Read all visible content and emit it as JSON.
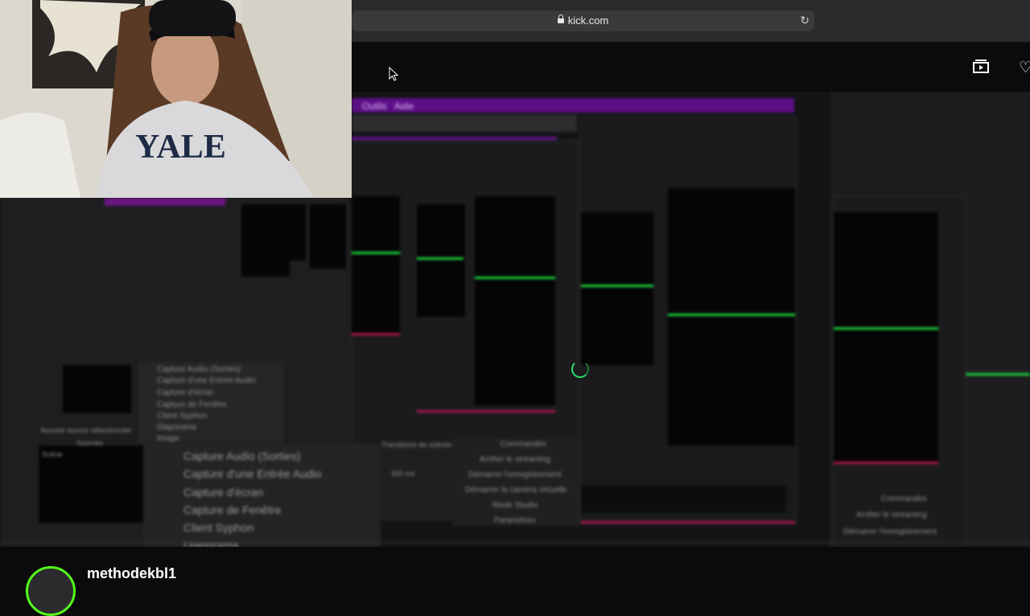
{
  "browser": {
    "url": "kick.com",
    "reload_icon": "reload-icon",
    "lock_icon": "lock-icon"
  },
  "header": {
    "theater_icon": "theater-mode-icon",
    "heart_icon": "follow-heart-icon"
  },
  "stream_content": {
    "menu_left": [
      "Outils",
      "Aide"
    ],
    "add_source_menu_small": [
      "Capture Audio (Sorties)",
      "Capture d'une Entrée Audio",
      "Capture d'écran",
      "Capture de Fenêtre",
      "Client Syphon",
      "Diaporama",
      "Image"
    ],
    "add_source_menu_large": [
      "Capture Audio (Sorties)",
      "Capture d'une Entrée Audio",
      "Capture d'écran",
      "Capture de Fenêtre",
      "Client Syphon",
      "Diaporama"
    ],
    "controls_title": "Commandes",
    "controls": [
      "Arrêter le streaming",
      "Démarrer l'enregistrement",
      "Démarrer la caméra virtuelle",
      "Mode Studio",
      "Paramètres"
    ],
    "right_controls_title": "Commandes",
    "right_controls": [
      "Arrêter le streaming",
      "Démarrer l'enregistrement"
    ],
    "no_source": "Aucune source sélectionnée",
    "scenes_label": "Scène",
    "sources_label": "Sources",
    "transitions_label": "Transitions de scènes",
    "transition_duration": "300 ms"
  },
  "channel": {
    "username": "methodekbl1"
  },
  "colors": {
    "kick_green": "#53fc18",
    "obs_purple": "#5d0f85",
    "audio_meter_green": "#1bd83b"
  }
}
